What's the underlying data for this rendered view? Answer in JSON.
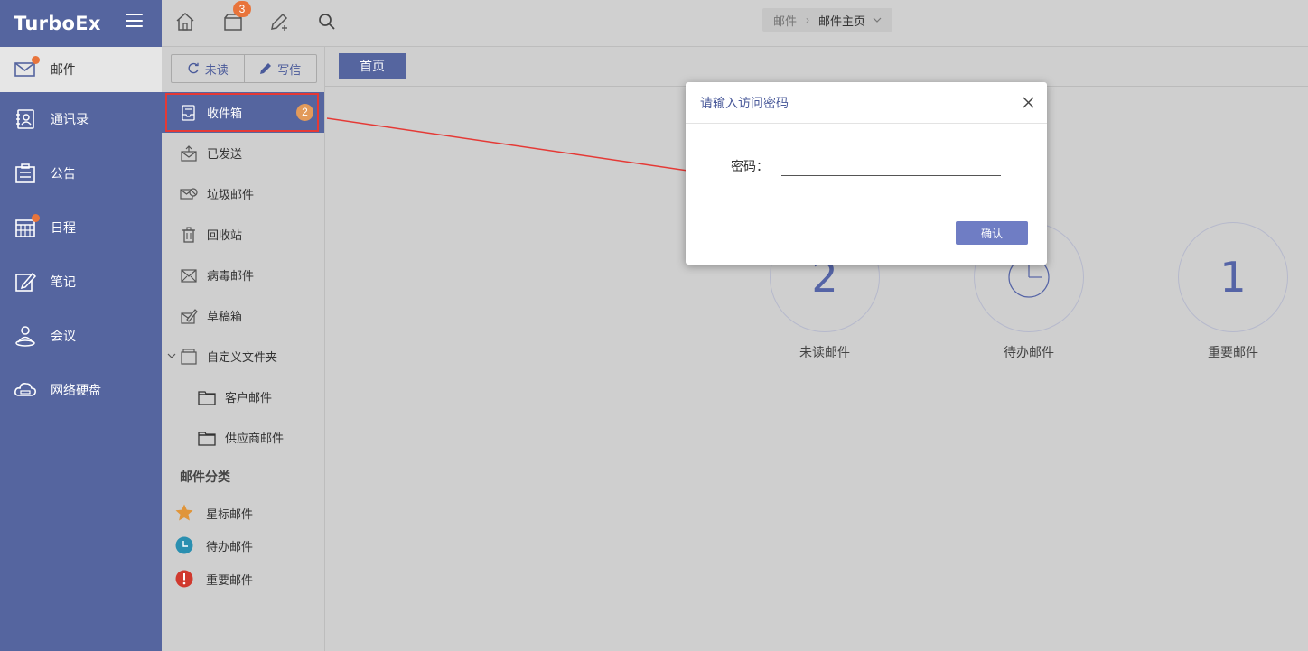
{
  "app": {
    "logo": "TurboEx"
  },
  "nav": {
    "items": [
      {
        "label": "邮件",
        "icon": "mail-icon",
        "dot": true
      },
      {
        "label": "通讯录",
        "icon": "contacts-icon",
        "dot": false
      },
      {
        "label": "公告",
        "icon": "announcement-icon",
        "dot": false
      },
      {
        "label": "日程",
        "icon": "calendar-icon",
        "dot": true
      },
      {
        "label": "笔记",
        "icon": "note-icon",
        "dot": false
      },
      {
        "label": "会议",
        "icon": "meeting-icon",
        "dot": false
      },
      {
        "label": "网络硬盘",
        "icon": "cloud-drive-icon",
        "dot": false
      }
    ]
  },
  "topbar": {
    "badge": "3",
    "breadcrumb": {
      "parent": "邮件",
      "current": "邮件主页"
    }
  },
  "mail": {
    "unread_btn": "未读",
    "compose_btn": "写信",
    "inbox_badge": "2",
    "folders": [
      {
        "label": "收件箱",
        "icon": "inbox-icon"
      },
      {
        "label": "已发送",
        "icon": "sent-icon"
      },
      {
        "label": "垃圾邮件",
        "icon": "spam-icon"
      },
      {
        "label": "回收站",
        "icon": "trash-icon"
      },
      {
        "label": "病毒邮件",
        "icon": "virus-mail-icon"
      },
      {
        "label": "草稿箱",
        "icon": "drafts-icon"
      },
      {
        "label": "自定义文件夹",
        "icon": "folder-icon"
      },
      {
        "label": "客户邮件",
        "icon": "folder-icon"
      },
      {
        "label": "供应商邮件",
        "icon": "folder-icon"
      }
    ],
    "category_title": "邮件分类",
    "categories": [
      {
        "label": "星标邮件",
        "icon": "star-icon",
        "color": "#e0953a"
      },
      {
        "label": "待办邮件",
        "icon": "clock-icon",
        "color": "#2a8fb0"
      },
      {
        "label": "重要邮件",
        "icon": "exclamation-icon",
        "color": "#d0392e"
      }
    ]
  },
  "main": {
    "tab": "首页",
    "stats": [
      {
        "value": "2",
        "label": "未读邮件"
      },
      {
        "value": "",
        "label": "待办邮件"
      },
      {
        "value": "1",
        "label": "重要邮件"
      }
    ]
  },
  "modal": {
    "title": "请输入访问密码",
    "password_label": "密码：",
    "password_value": "",
    "confirm": "确认"
  },
  "colors": {
    "primary": "#55659f",
    "badge": "#e8743b",
    "highlight": "#e53935",
    "confirm": "#6f7dc4"
  }
}
